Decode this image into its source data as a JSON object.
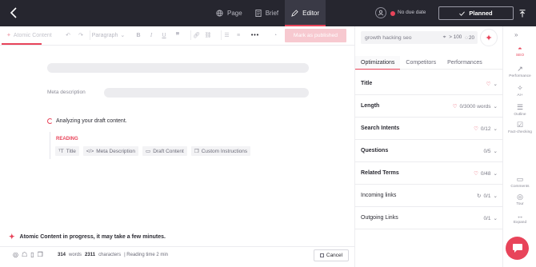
{
  "topbar": {
    "tabs": [
      {
        "label": "Page",
        "icon": "globe-icon"
      },
      {
        "label": "Brief",
        "icon": "document-icon"
      },
      {
        "label": "Editor",
        "icon": "pen-icon",
        "active": true
      }
    ],
    "due_date": "No due date",
    "status_button": "Planned",
    "accent_color": "#e8445a"
  },
  "toolbar": {
    "atomic_label": "Atomic Content",
    "paragraph_select": "Paragraph",
    "mark_published": "Mark as published"
  },
  "editor": {
    "meta_description_label": "Meta description",
    "analyzing_text": "Analyzing your draft content.",
    "reading_title": "READING",
    "chips": [
      "Title",
      "Meta Description",
      "Draft Content",
      "Custom Instructions"
    ],
    "progress_message": "Atomic Content in progress, it may take a few minutes."
  },
  "statusbar": {
    "words_count": "314",
    "words_label": "words",
    "chars_count": "2311",
    "chars_label": "characters",
    "reading_time": "| Reading time 2 min",
    "cancel_label": "Cancel"
  },
  "panel": {
    "keyword": "growth hacking seo",
    "volume": "> 100",
    "difficulty": "20",
    "tabs": [
      "Optimizations",
      "Competitors",
      "Performances"
    ],
    "rows": [
      {
        "label": "Title",
        "value": ""
      },
      {
        "label": "Length",
        "value": "0/3000 words"
      },
      {
        "label": "Search Intents",
        "value": "0/12"
      },
      {
        "label": "Questions",
        "value": "0/5"
      },
      {
        "label": "Related Terms",
        "value": "0/48"
      },
      {
        "label": "Incoming links",
        "value": "0/1"
      },
      {
        "label": "Outgoing Links",
        "value": "0/1"
      }
    ]
  },
  "rail": {
    "items": [
      "SEO",
      "Performance",
      "AI+",
      "Outline",
      "Fact-checking",
      "Comments",
      "Tour",
      "Expand"
    ]
  }
}
